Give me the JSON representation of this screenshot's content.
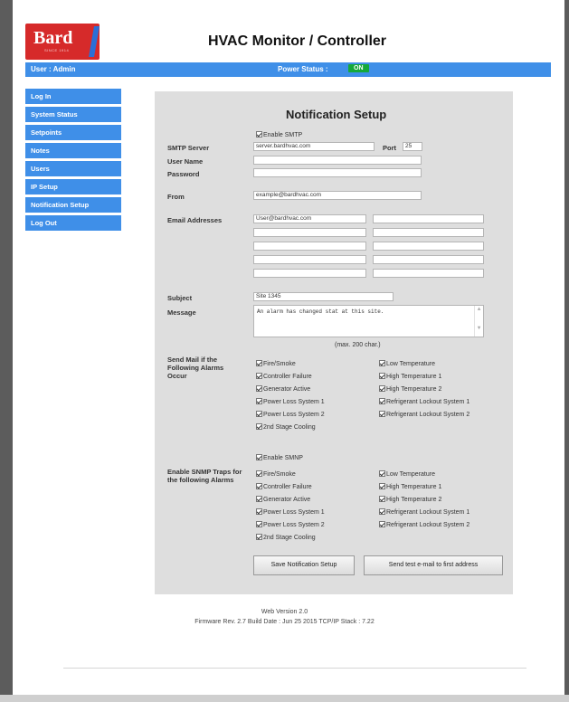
{
  "header": {
    "logo": "Bard",
    "logo_tagline": "SINCE 1914",
    "title": "HVAC Monitor / Controller"
  },
  "status_bar": {
    "user": "User : Admin",
    "power_label": "Power Status :",
    "power_value": "ON",
    "power_color": "#14a83a"
  },
  "sidebar": {
    "items": [
      {
        "label": "Log In"
      },
      {
        "label": "System Status"
      },
      {
        "label": "Setpoints"
      },
      {
        "label": "Notes"
      },
      {
        "label": "Users"
      },
      {
        "label": "IP Setup"
      },
      {
        "label": "Notification Setup"
      },
      {
        "label": "Log Out"
      }
    ]
  },
  "panel": {
    "title": "Notification Setup",
    "smtp": {
      "enable_label": "Enable SMTP",
      "server_label": "SMTP Server",
      "server_value": "server.bardhvac.com",
      "port_label": "Port",
      "port_value": "25",
      "username_label": "User Name",
      "username_value": "",
      "password_label": "Password",
      "password_value": "",
      "from_label": "From",
      "from_value": "example@bardhvac.com"
    },
    "email": {
      "label": "Email Addresses",
      "addresses": [
        "User@bardhvac.com",
        "",
        "",
        "",
        "",
        "",
        "",
        "",
        "",
        ""
      ]
    },
    "subject_label": "Subject",
    "subject_value": "Site 1345",
    "message_label": "Message",
    "message_value": "An alarm has changed stat at this site.",
    "message_hint": "(max. 200 char.)",
    "alarms": {
      "label": "Send Mail if the Following Alarms Occur",
      "left": [
        "Fire/Smoke",
        "Controller Failure",
        "Generator Active",
        "Power Loss System 1",
        "Power Loss System 2",
        "2nd Stage Cooling"
      ],
      "right": [
        "Low Temperature",
        "High Temperature 1",
        "High Temperature 2",
        "Refrigerant Lockout System 1",
        "Refrigerant Lockout System 2"
      ]
    },
    "snmp": {
      "enable_label": "Enable SMNP",
      "label": "Enable SNMP Traps for the following Alarms",
      "left": [
        "Fire/Smoke",
        "Controller Failure",
        "Generator Active",
        "Power Loss System 1",
        "Power Loss System 2",
        "2nd Stage Cooling"
      ],
      "right": [
        "Low Temperature",
        "High Temperature 1",
        "High Temperature 2",
        "Refrigerant Lockout System 1",
        "Refrigerant Lockout System 2"
      ]
    },
    "save_button": "Save Notification Setup",
    "test_button": "Send test e-mail to first address"
  },
  "footer": {
    "web_version": "Web Version 2.0",
    "firmware": "Firmware Rev. 2.7 Build Date : Jun 25 2015   TCP/IP Stack : 7.22"
  }
}
